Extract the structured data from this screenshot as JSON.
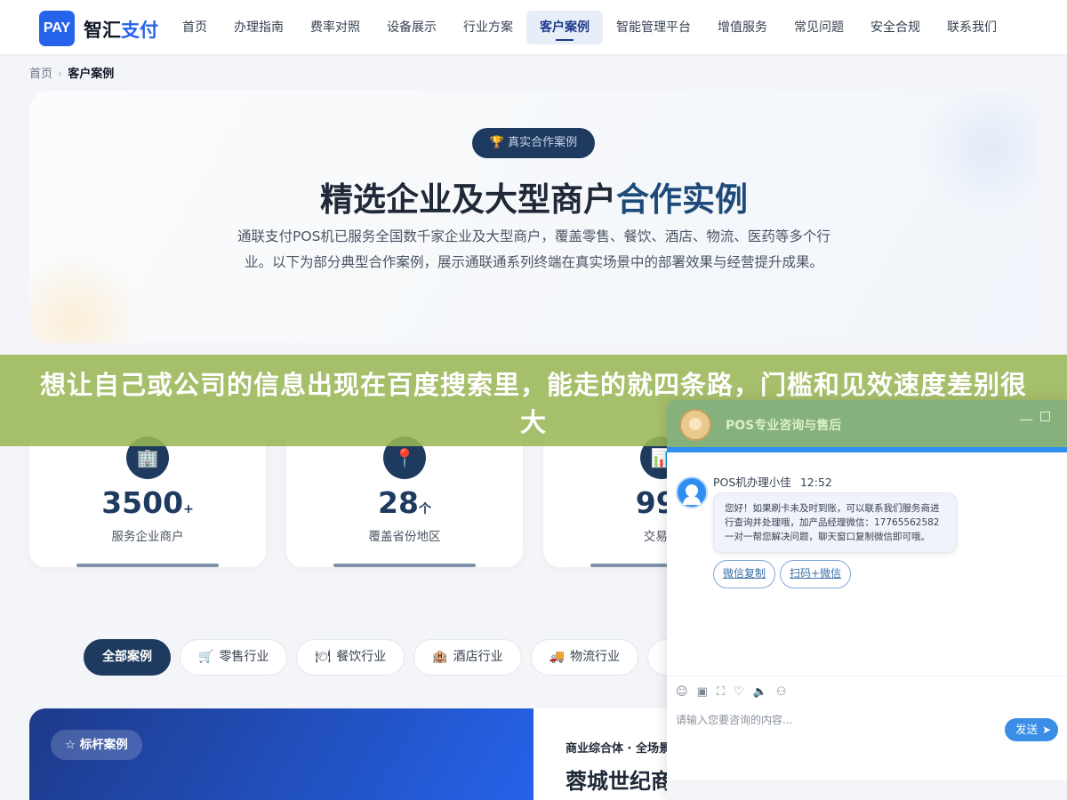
{
  "nav": {
    "logo_badge": "PAY",
    "logo_main": "智汇",
    "logo_accent": "支付",
    "items": [
      {
        "label": "首页"
      },
      {
        "label": "办理指南"
      },
      {
        "label": "费率对照"
      },
      {
        "label": "设备展示"
      },
      {
        "label": "行业方案"
      },
      {
        "label": "客户案例",
        "active": true
      },
      {
        "label": "智能管理平台"
      },
      {
        "label": "增值服务"
      },
      {
        "label": "常见问题"
      },
      {
        "label": "安全合规"
      },
      {
        "label": "联系我们"
      }
    ]
  },
  "breadcrumb": {
    "home": "首页",
    "separator": "›",
    "current": "客户案例"
  },
  "hero": {
    "badge": "真实合作案例",
    "title_main": "精选企业及大型商户",
    "title_accent": "合作实例",
    "description": "通联支付POS机已服务全国数千家企业及大型商户，覆盖零售、餐饮、酒店、物流、医药等多个行业。以下为部分典型合作案例，展示通联通系列终端在真实场景中的部署效果与经营提升成果。"
  },
  "stats": [
    {
      "icon": "building-icon",
      "glyph": "🏢",
      "value": "3500",
      "unit": "+",
      "label": "服务企业商户"
    },
    {
      "icon": "map-pin-icon",
      "glyph": "📍",
      "value": "28",
      "unit": "个",
      "label": "覆盖省份地区"
    },
    {
      "icon": "chart-icon",
      "glyph": "📊",
      "value": "99.",
      "unit": "",
      "label": "交易成"
    }
  ],
  "filters": [
    {
      "label": "全部案例",
      "icon": "",
      "active": true
    },
    {
      "label": "零售行业",
      "icon": "🛒"
    },
    {
      "label": "餐饮行业",
      "icon": "🍽"
    },
    {
      "label": "酒店行业",
      "icon": "🏨"
    },
    {
      "label": "物流行业",
      "icon": "🚚"
    },
    {
      "label": "",
      "icon": "💊"
    }
  ],
  "case": {
    "tag": "☆ 标杆案例",
    "meta": "商业综合体 · 全场景",
    "title": "蓉城世纪商"
  },
  "banner": {
    "text": "想让自己或公司的信息出现在百度搜索里，能走的就四条路，门槛和见效速度差别很大"
  },
  "chat": {
    "title": "POS专业咨询与售后",
    "agent_name": "POS机办理小佳",
    "time": "12:52",
    "message": "您好！如果刷卡未及时到账，可以联系我们服务商进行查询并处理哦，加产品经理微信：17765562582 一对一帮您解决问题，聊天窗口复制微信即可哦。",
    "quick_replies": [
      "微信复制",
      "扫码+微信"
    ],
    "input_placeholder": "请输入您要咨询的内容...",
    "send_label": "发送",
    "tools": [
      "emoji-icon",
      "image-icon",
      "screenshot-icon",
      "rate-icon",
      "voice-icon",
      "wechat-icon"
    ]
  }
}
